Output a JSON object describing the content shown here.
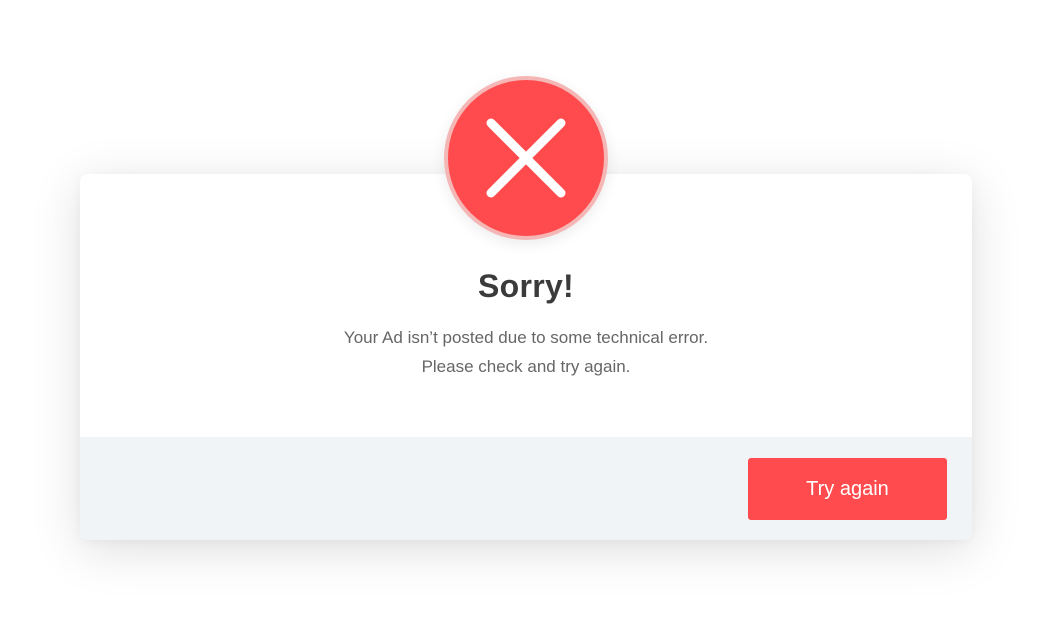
{
  "dialog": {
    "title": "Sorry!",
    "message_lines": [
      "Your Ad isn’t posted due to some technical error.",
      "Please check and try again."
    ],
    "button_label": "Try again",
    "icon": "close-icon"
  },
  "colors": {
    "accent": "#ff4b4d",
    "icon_ring": "#f5b7b6",
    "footer_background": "#f1f4f7",
    "title_text": "#3b3b3b",
    "message_text": "#666666"
  }
}
